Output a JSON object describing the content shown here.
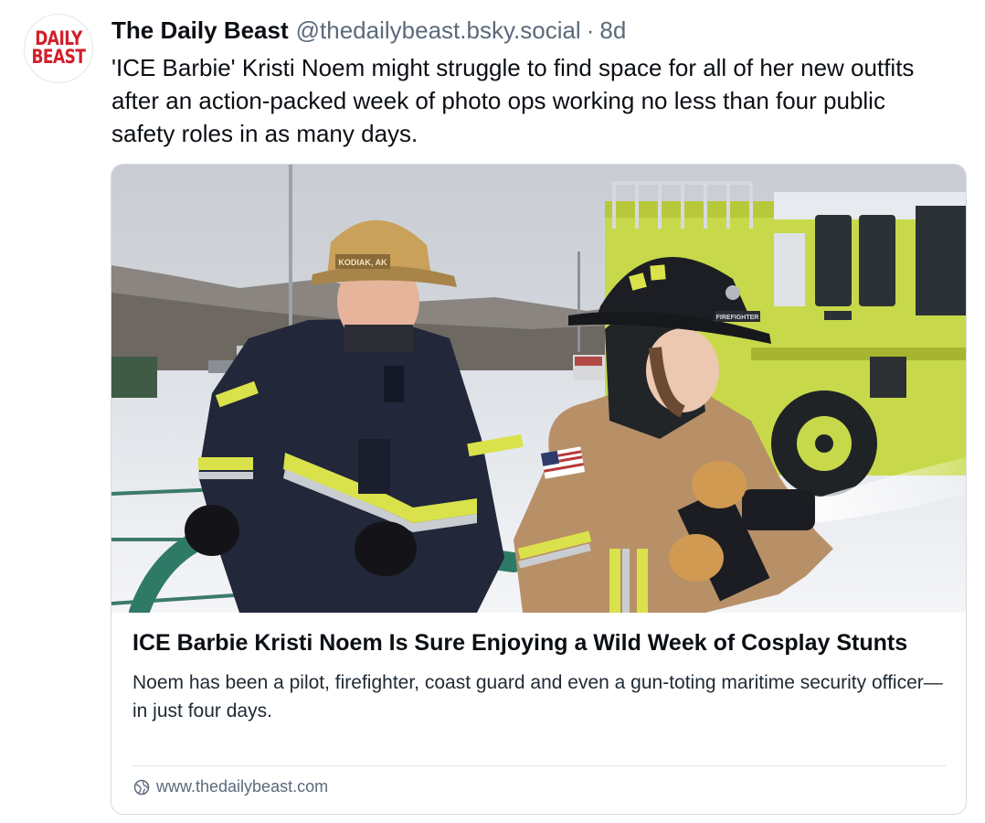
{
  "author": {
    "avatar_text_line1": "DAILY",
    "avatar_text_line2": "BEAST",
    "display_name": "The Daily Beast",
    "handle": "@thedailybeast.bsky.social",
    "separator": "·",
    "time": "8d"
  },
  "post": {
    "text": "'ICE Barbie' Kristi Noem might struggle to find space for all of her new outfits after an action-packed week of photo ops working no less than four public safety roles in as many days."
  },
  "link_card": {
    "image_alt": "Two firefighters in turnout gear holding a water hose in front of a yellow-green fire truck in the snow",
    "helmet_text_left": "KODIAK, AK",
    "helmet_text_right": "FIREFIGHTER",
    "title": "ICE Barbie Kristi Noem Is Sure Enjoying a Wild Week of Cosplay Stunts",
    "description": "Noem has been a pilot, firefighter, coast guard and even a gun-toting maritime security officer—in just four days.",
    "domain": "www.thedailybeast.com",
    "domain_icon": "globe-icon"
  },
  "colors": {
    "brand_red": "#d21f2b",
    "secondary_text": "#5b6a7b",
    "border": "#d4dbe2",
    "truck_green": "#c7d94a"
  }
}
